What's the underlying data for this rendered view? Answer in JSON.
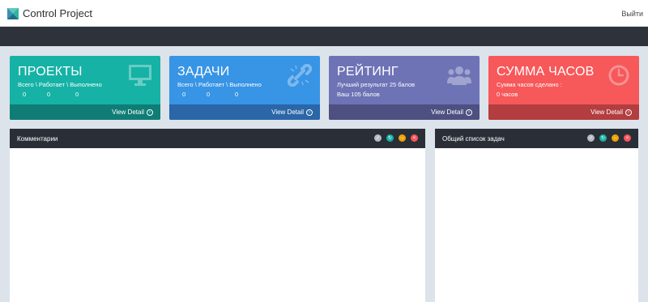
{
  "app": {
    "brand": "Control Project",
    "logout_label": "Выйти"
  },
  "cards": [
    {
      "title": "ПРОЕКТЫ",
      "line1": "Всего \\ Работает \\ Выполнено",
      "nums": [
        "0",
        "0",
        "0"
      ],
      "detail": "View Detail",
      "icon": "monitor-icon"
    },
    {
      "title": "ЗАДАЧИ",
      "line1": "Всего \\ Работает \\ Выполнено",
      "nums": [
        "0",
        "0",
        "0"
      ],
      "detail": "View Detail",
      "icon": "chain-link-icon"
    },
    {
      "title": "РЕЙТИНГ",
      "line1": "Лучший результат 25 балов",
      "line2": "Ваш 105 балов",
      "detail": "View Detail",
      "icon": "users-icon"
    },
    {
      "title": "СУММА ЧАСОВ",
      "line1": "Сумма часов сделано :",
      "line2": "0 часов",
      "detail": "View Detail",
      "icon": "clock-icon"
    }
  ],
  "panels": [
    {
      "title": "Комментарии"
    },
    {
      "title": "Общий список задач"
    }
  ],
  "colors": {
    "teal": "#16b2a6",
    "blue": "#3894e5",
    "purple": "#6e73b6",
    "red": "#f7585a",
    "dark": "#2e333b"
  }
}
